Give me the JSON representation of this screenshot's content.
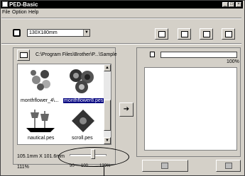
{
  "window": {
    "title": "PED-Basic",
    "caption_buttons": [
      "_",
      "□",
      "×"
    ]
  },
  "menu": {
    "items": [
      "File",
      "Option",
      "Help"
    ]
  },
  "toolbar": {
    "frame_size": "130X180mm"
  },
  "browser": {
    "path": "C:\\Program Files\\Brother\\P...\\Sample",
    "thumbnails": [
      {
        "label": "monthflower_4\\...",
        "selected": false,
        "icon": "flower-wreath-icon"
      },
      {
        "label": "monthflower8.pes",
        "selected": true,
        "icon": "sunflowers-icon"
      },
      {
        "label": "nautical.pes",
        "selected": false,
        "icon": "ship-icon"
      },
      {
        "label": "scroll.pes",
        "selected": false,
        "icon": "scroll-ornament-icon"
      }
    ],
    "dimensions": "105.1mm X 101.6mm",
    "zoom": "111%",
    "slider": {
      "ticks": [
        "90",
        "100",
        "120%"
      ],
      "value_percent": 111
    }
  },
  "card": {
    "progress_label": "100%",
    "progress_value": 0
  },
  "colors": {
    "selection": "#000080",
    "face": "#d4d0c8"
  }
}
